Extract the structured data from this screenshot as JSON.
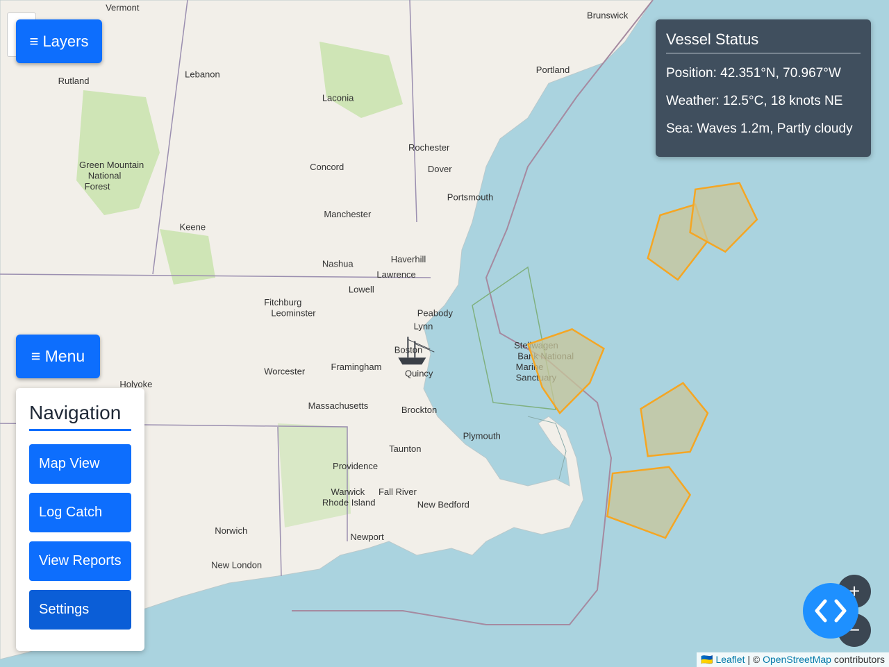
{
  "colors": {
    "water": "#aad3df",
    "land": "#f2efe9",
    "forest": "#cfe5b6",
    "zone_fill": "#c8c59a",
    "zone_stroke": "#f5a623",
    "accent": "#0d6efd"
  },
  "controls": {
    "layers_label": "≡ Layers",
    "menu_label": "≡ Menu"
  },
  "navigation": {
    "title": "Navigation",
    "items": [
      {
        "label": "Map View"
      },
      {
        "label": "Log Catch"
      },
      {
        "label": "View Reports"
      },
      {
        "label": "Settings"
      }
    ]
  },
  "vessel_status": {
    "title": "Vessel Status",
    "position": "Position: 42.351°N, 70.967°W",
    "weather": "Weather: 12.5°C, 18 knots NE",
    "sea": "Sea: Waves 1.2m, Partly cloudy"
  },
  "zoom": {
    "in": "+",
    "out": "−"
  },
  "attribution": {
    "flag": "🇺🇦",
    "leaflet": "Leaflet",
    "sep": " | © ",
    "osm": "OpenStreetMap",
    "rest": " contributors"
  },
  "map_labels": [
    {
      "text": "Brunswick",
      "lat": 43.914,
      "lon": -69.966
    },
    {
      "text": "Portland",
      "lat": 43.661,
      "lon": -70.255
    },
    {
      "text": "Vermont",
      "lat": 43.95,
      "lon": -72.7
    },
    {
      "text": "Rutland",
      "lat": 43.61,
      "lon": -72.97
    },
    {
      "text": "Lebanon",
      "lat": 43.64,
      "lon": -72.25
    },
    {
      "text": "Laconia",
      "lat": 43.53,
      "lon": -71.47
    },
    {
      "text": "Rochester",
      "lat": 43.3,
      "lon": -70.98
    },
    {
      "text": "Dover",
      "lat": 43.2,
      "lon": -70.87
    },
    {
      "text": "Concord",
      "lat": 43.21,
      "lon": -71.54
    },
    {
      "text": "Portsmouth",
      "lat": 43.07,
      "lon": -70.76
    },
    {
      "text": "Manchester",
      "lat": 42.99,
      "lon": -71.46
    },
    {
      "text": "Keene",
      "lat": 42.93,
      "lon": -72.28
    },
    {
      "text": "Nashua",
      "lat": 42.76,
      "lon": -71.47
    },
    {
      "text": "Haverhill",
      "lat": 42.78,
      "lon": -71.08
    },
    {
      "text": "Lawrence",
      "lat": 42.71,
      "lon": -71.16
    },
    {
      "text": "Lowell",
      "lat": 42.64,
      "lon": -71.32
    },
    {
      "text": "Fitchburg",
      "lat": 42.58,
      "lon": -71.8
    },
    {
      "text": "Leominster",
      "lat": 42.53,
      "lon": -71.76
    },
    {
      "text": "Peabody",
      "lat": 42.53,
      "lon": -70.93
    },
    {
      "text": "Lynn",
      "lat": 42.47,
      "lon": -70.95
    },
    {
      "text": "Boston",
      "lat": 42.36,
      "lon": -71.06
    },
    {
      "text": "Worcester",
      "lat": 42.26,
      "lon": -71.8
    },
    {
      "text": "Framingham",
      "lat": 42.28,
      "lon": -71.42
    },
    {
      "text": "Quincy",
      "lat": 42.25,
      "lon": -71.0
    },
    {
      "text": "Holyoke",
      "lat": 42.2,
      "lon": -72.62
    },
    {
      "text": "Brockton",
      "lat": 42.08,
      "lon": -71.02
    },
    {
      "text": "Massachusetts",
      "lat": 42.1,
      "lon": -71.55
    },
    {
      "text": "Plymouth",
      "lat": 41.96,
      "lon": -70.67
    },
    {
      "text": "Taunton",
      "lat": 41.9,
      "lon": -71.09
    },
    {
      "text": "Providence",
      "lat": 41.82,
      "lon": -71.41
    },
    {
      "text": "Warwick",
      "lat": 41.7,
      "lon": -71.42
    },
    {
      "text": "Fall River",
      "lat": 41.7,
      "lon": -71.15
    },
    {
      "text": "New Bedford",
      "lat": 41.64,
      "lon": -70.93
    },
    {
      "text": "Rhode Island",
      "lat": 41.65,
      "lon": -71.47
    },
    {
      "text": "Newport",
      "lat": 41.49,
      "lon": -71.31
    },
    {
      "text": "Norwich",
      "lat": 41.52,
      "lon": -72.08
    },
    {
      "text": "New London",
      "lat": 41.36,
      "lon": -72.1
    },
    {
      "text": "Green Mountain",
      "lat": 43.22,
      "lon": -72.85
    },
    {
      "text": "National",
      "lat": 43.17,
      "lon": -72.8
    },
    {
      "text": "Forest",
      "lat": 43.12,
      "lon": -72.82
    },
    {
      "text": "Stellwagen",
      "lat": 42.38,
      "lon": -70.38
    },
    {
      "text": "Bank National",
      "lat": 42.33,
      "lon": -70.36
    },
    {
      "text": "Marine",
      "lat": 42.28,
      "lon": -70.37
    },
    {
      "text": "Sanctuary",
      "lat": 42.23,
      "lon": -70.37
    }
  ],
  "vessel": {
    "lat": 42.351,
    "lon": -70.967
  },
  "fishing_zones": [
    [
      [
        43.0,
        -69.55
      ],
      [
        43.05,
        -69.35
      ],
      [
        42.88,
        -69.28
      ],
      [
        42.7,
        -69.45
      ],
      [
        42.8,
        -69.62
      ]
    ],
    [
      [
        43.12,
        -69.35
      ],
      [
        43.15,
        -69.1
      ],
      [
        42.98,
        -69.0
      ],
      [
        42.83,
        -69.18
      ],
      [
        42.92,
        -69.38
      ]
    ],
    [
      [
        42.47,
        -70.05
      ],
      [
        42.38,
        -69.87
      ],
      [
        42.22,
        -69.95
      ],
      [
        42.08,
        -70.12
      ],
      [
        42.2,
        -70.22
      ],
      [
        42.4,
        -70.3
      ]
    ],
    [
      [
        42.22,
        -69.42
      ],
      [
        42.08,
        -69.28
      ],
      [
        41.9,
        -69.38
      ],
      [
        41.88,
        -69.62
      ],
      [
        42.1,
        -69.66
      ]
    ],
    [
      [
        41.83,
        -69.5
      ],
      [
        41.7,
        -69.38
      ],
      [
        41.5,
        -69.52
      ],
      [
        41.6,
        -69.85
      ],
      [
        41.8,
        -69.82
      ]
    ]
  ],
  "map_view": {
    "west": -73.3,
    "east": -68.25,
    "north": 44.0,
    "south": 40.9
  }
}
